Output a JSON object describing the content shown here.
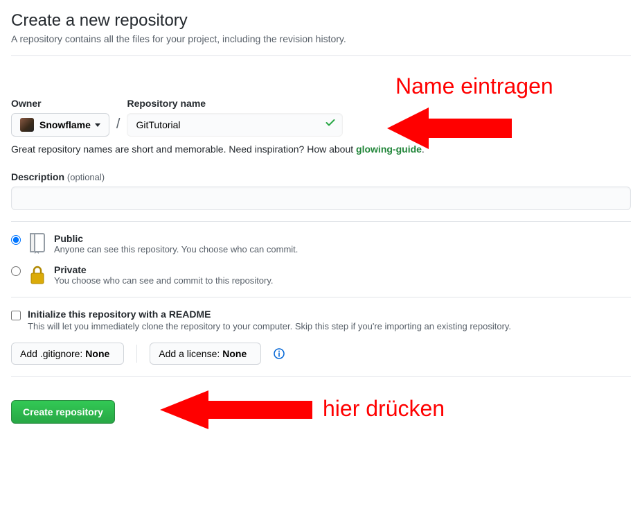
{
  "page_title": "Create a new repository",
  "subtitle": "A repository contains all the files for your project, including the revision history.",
  "owner": {
    "label": "Owner",
    "selected": "Snowflame"
  },
  "repo_name": {
    "label": "Repository name",
    "value": "GitTutorial"
  },
  "name_hint": {
    "text_prefix": "Great repository names are short and memorable. Need inspiration? How about ",
    "suggestion": "glowing-guide",
    "suffix": "."
  },
  "description": {
    "label": "Description",
    "optional_label": "(optional)",
    "value": ""
  },
  "visibility": {
    "public": {
      "title": "Public",
      "desc": "Anyone can see this repository. You choose who can commit.",
      "selected": true
    },
    "private": {
      "title": "Private",
      "desc": "You choose who can see and commit to this repository.",
      "selected": false
    }
  },
  "init": {
    "title": "Initialize this repository with a README",
    "desc": "This will let you immediately clone the repository to your computer. Skip this step if you're importing an existing repository.",
    "checked": false
  },
  "gitignore": {
    "label_prefix": "Add .gitignore:",
    "value": "None"
  },
  "license": {
    "label_prefix": "Add a license:",
    "value": "None"
  },
  "submit_label": "Create repository",
  "annotations": {
    "name_hint": "Name eintragen",
    "press_hint": "hier drücken"
  }
}
